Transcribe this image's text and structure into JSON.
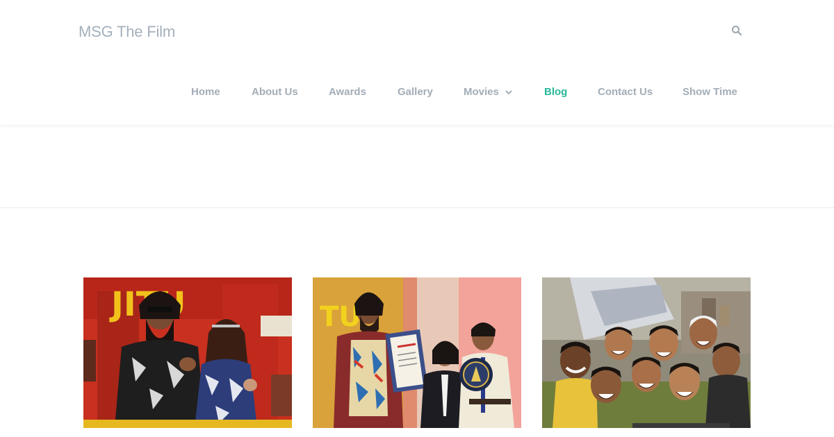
{
  "header": {
    "site_title": "MSG The Film",
    "search_icon": "search-icon"
  },
  "nav": {
    "items": [
      {
        "label": "Home"
      },
      {
        "label": "About Us"
      },
      {
        "label": "Awards"
      },
      {
        "label": "Gallery"
      },
      {
        "label": "Movies",
        "has_dropdown": true,
        "dropdown_icon": "chevron-down-icon"
      },
      {
        "label": "Blog",
        "active": true
      },
      {
        "label": "Contact Us"
      },
      {
        "label": "Show Time"
      }
    ]
  },
  "posts": [
    {
      "image": "photo-event-red-backdrop"
    },
    {
      "image": "photo-award-certificate"
    },
    {
      "image": "photo-group-selfie"
    }
  ],
  "colors": {
    "title_gray": "#a3b0bc",
    "nav_gray": "#a3adb7",
    "nav_active": "#27b899",
    "divider": "#e8ecef"
  }
}
